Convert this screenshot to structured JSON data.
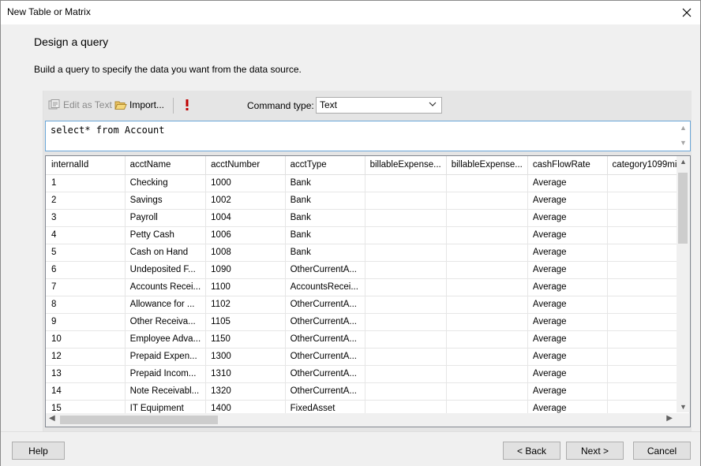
{
  "window": {
    "title": "New Table or Matrix"
  },
  "page": {
    "heading": "Design a query",
    "description": "Build a query to specify the data you want from the data source."
  },
  "toolbar": {
    "edit_as_text": "Edit as Text",
    "import": "Import...",
    "command_type_label": "Command type:",
    "command_type_value": "Text"
  },
  "query": {
    "text": "select* from Account"
  },
  "grid": {
    "columns": [
      "internalId",
      "acctName",
      "acctNumber",
      "acctType",
      "billableExpense...",
      "billableExpense...",
      "cashFlowRate",
      "category1099mi..."
    ],
    "rows": [
      [
        "1",
        "Checking",
        "1000",
        "Bank",
        "",
        "",
        "Average",
        ""
      ],
      [
        "2",
        "Savings",
        "1002",
        "Bank",
        "",
        "",
        "Average",
        ""
      ],
      [
        "3",
        "Payroll",
        "1004",
        "Bank",
        "",
        "",
        "Average",
        ""
      ],
      [
        "4",
        "Petty Cash",
        "1006",
        "Bank",
        "",
        "",
        "Average",
        ""
      ],
      [
        "5",
        "Cash on Hand",
        "1008",
        "Bank",
        "",
        "",
        "Average",
        ""
      ],
      [
        "6",
        "Undeposited F...",
        "1090",
        "OtherCurrentA...",
        "",
        "",
        "Average",
        ""
      ],
      [
        "7",
        "Accounts Recei...",
        "1100",
        "AccountsRecei...",
        "",
        "",
        "Average",
        ""
      ],
      [
        "8",
        "Allowance for ...",
        "1102",
        "OtherCurrentA...",
        "",
        "",
        "Average",
        ""
      ],
      [
        "9",
        "Other Receiva...",
        "1105",
        "OtherCurrentA...",
        "",
        "",
        "Average",
        ""
      ],
      [
        "10",
        "Employee Adva...",
        "1150",
        "OtherCurrentA...",
        "",
        "",
        "Average",
        ""
      ],
      [
        "12",
        "Prepaid Expen...",
        "1300",
        "OtherCurrentA...",
        "",
        "",
        "Average",
        ""
      ],
      [
        "13",
        "Prepaid Incom...",
        "1310",
        "OtherCurrentA...",
        "",
        "",
        "Average",
        ""
      ],
      [
        "14",
        "Note Receivabl...",
        "1320",
        "OtherCurrentA...",
        "",
        "",
        "Average",
        ""
      ],
      [
        "15",
        "IT Equipment",
        "1400",
        "FixedAsset",
        "",
        "",
        "Average",
        ""
      ]
    ]
  },
  "footer": {
    "help": "Help",
    "back": "< Back",
    "next": "Next >",
    "cancel": "Cancel"
  },
  "icons": {
    "close": "close-icon",
    "edit_as_text": "edit-text-icon",
    "import": "folder-open-icon",
    "run": "exclamation-run-icon",
    "dropdown": "chevron-down-icon"
  },
  "colors": {
    "run_icon": "#c00000",
    "query_border": "#6aa6d8"
  }
}
